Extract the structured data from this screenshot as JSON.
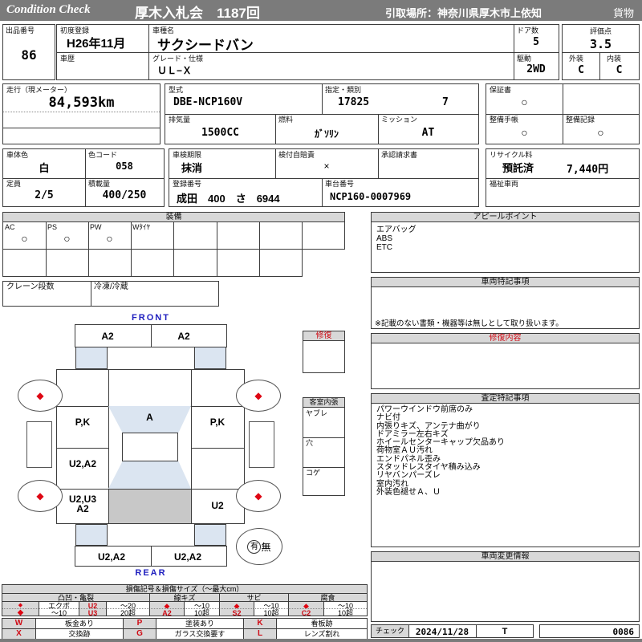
{
  "header": {
    "logo": "Condition  Check",
    "title": "厚木入札会　1187回",
    "pickup": "引取場所：神奈川県厚木市上依知",
    "category": "貨物"
  },
  "icons": {
    "circle": "○",
    "cross": "×",
    "diamond": "◆"
  },
  "colors": {
    "header_bg": "#7b7b7b",
    "accent_red": "#cf0b15",
    "diagram_blue_fill": "#dbe5f1",
    "cargo_gray": "#c8c8c8",
    "panel_header_gray": "#d8d8d8",
    "front_rear_blue": "#2020bf"
  },
  "info": {
    "lot_label": "出品番号",
    "lot_value": "86",
    "first_reg_label": "初度登録",
    "first_reg_value": "H26年11月",
    "model_name_label": "車種名",
    "model_name_value": "サクシードバン",
    "history_label": "車歴",
    "grade_label": "グレード・仕様",
    "grade_value": "ＵＬ−Ｘ",
    "doors_label": "ドア数",
    "doors_value": "5",
    "score_label": "評価点",
    "score_value": "3.5",
    "drive_label": "駆動",
    "drive_value": "2WD",
    "exterior_label": "外装",
    "exterior_value": "C",
    "interior_label": "内装",
    "interior_value": "C",
    "mileage_label": "走行（現メーター）",
    "mileage_value": "84,593km",
    "model_code_label": "型式",
    "model_code_value": "DBE-NCP160V",
    "class_label": "指定・類別",
    "class_value1": "17825",
    "class_value2": "7",
    "warranty_label": "保証書",
    "displacement_label": "排気量",
    "displacement_value": "1500CC",
    "fuel_label": "燃料",
    "fuel_value": "ｶﾞｿﾘﾝ",
    "transmission_label": "ミッション",
    "transmission_value": "AT",
    "maintenance_book_label": "整備手帳",
    "maintenance_record_label": "整備記録",
    "body_color_label": "車体色",
    "body_color_value": "白",
    "color_code_label": "色コード",
    "color_code_value": "058",
    "inspection_label": "車検期限",
    "inspection_value": "抹消",
    "insurance_label": "検付自賠責",
    "approval_label": "承認請求書",
    "recycle_label": "リサイクル料",
    "recycle_status": "預託済",
    "recycle_fee": "7,440円",
    "capacity_label": "定員",
    "capacity_value": "2/5",
    "load_label": "積載量",
    "load_value": "400/250",
    "plate_label": "登録番号",
    "plate_value": "成田　400　さ　6944",
    "vin_label": "車台番号",
    "vin_value": "NCP160-0007969",
    "welfare_label": "福祉車両"
  },
  "equipment": {
    "title": "装備",
    "items": [
      {
        "label": "AC",
        "value": "○"
      },
      {
        "label": "PS",
        "value": "○"
      },
      {
        "label": "PW",
        "value": "○"
      },
      {
        "label": "Wﾀｲﾔ",
        "value": ""
      }
    ],
    "crane_label": "クレーン段数",
    "freezer_label": "冷凍/冷蔵"
  },
  "appeal": {
    "title": "アピールポイント",
    "items": [
      "エアバッグ",
      "ABS",
      "ETC"
    ]
  },
  "vehicle_notes": {
    "title": "車両特記事項",
    "note": "※記載のない書類・機器等は無しとして取り扱います。"
  },
  "repair": {
    "title": "修復内容"
  },
  "assessment": {
    "title": "査定特記事項",
    "items": [
      "パワーウインドウ前席のみ",
      "ナビ付",
      "内張りキズ、アンテナ曲がり",
      "ドアミラー左右キズ",
      "ホイールセンターキャップ欠品あり",
      "荷物室ＡＵ汚れ",
      "エンドパネル歪み",
      "スタッドレスタイヤ積み込み",
      "リヤバンパーズレ",
      "室内汚れ",
      "外装色褪せＡ、Ｕ"
    ]
  },
  "change_info": {
    "title": "車両変更情報"
  },
  "check": {
    "label": "チェック",
    "date": "2024/11/28",
    "inspector": "T",
    "number": "0086"
  },
  "diagram": {
    "front_label": "FRONT",
    "rear_label": "REAR",
    "front_bumper_left": "A2",
    "front_bumper_right": "A2",
    "left_front_panel": "P,K",
    "windshield": "A",
    "right_front_panel": "P,K",
    "left_center_panel": "U2,A2",
    "left_rear_panel_line1": "U2,U3",
    "left_rear_panel_line2": "A2",
    "right_rear_panel": "U2",
    "rear_bumper_left": "U2,A2",
    "rear_bumper_right": "U2,A2",
    "spare_yes": "有",
    "spare_no": "無",
    "repair_box_label": "修復",
    "cabin_title": "客室内張",
    "cabin_items": [
      "ヤブレ",
      "穴",
      "コゲ"
    ]
  },
  "legend": {
    "title": "損傷記号＆損傷サイズ（～最大cm）",
    "categories": [
      "凸凹・亀裂",
      "線キズ",
      "サビ",
      "腐食"
    ],
    "dent": {
      "row1": [
        "エクボ",
        "U2",
        "～20"
      ],
      "row2": [
        "～10",
        "U3",
        "20超"
      ]
    },
    "scratch": {
      "code": "A2",
      "size1": "～10",
      "size2": "10超"
    },
    "rust": {
      "code": "S2",
      "size1": "～10",
      "size2": "10超"
    },
    "corrosion": {
      "code": "C2",
      "size1": "～10",
      "size2": "10超"
    },
    "symbols": [
      {
        "code": "W",
        "label": "板金あり"
      },
      {
        "code": "P",
        "label": "塗装あり"
      },
      {
        "code": "K",
        "label": "看板跡"
      },
      {
        "code": "X",
        "label": "交換跡"
      },
      {
        "code": "G",
        "label": "ガラス交換要す"
      },
      {
        "code": "L",
        "label": "レンズ割れ"
      }
    ]
  }
}
